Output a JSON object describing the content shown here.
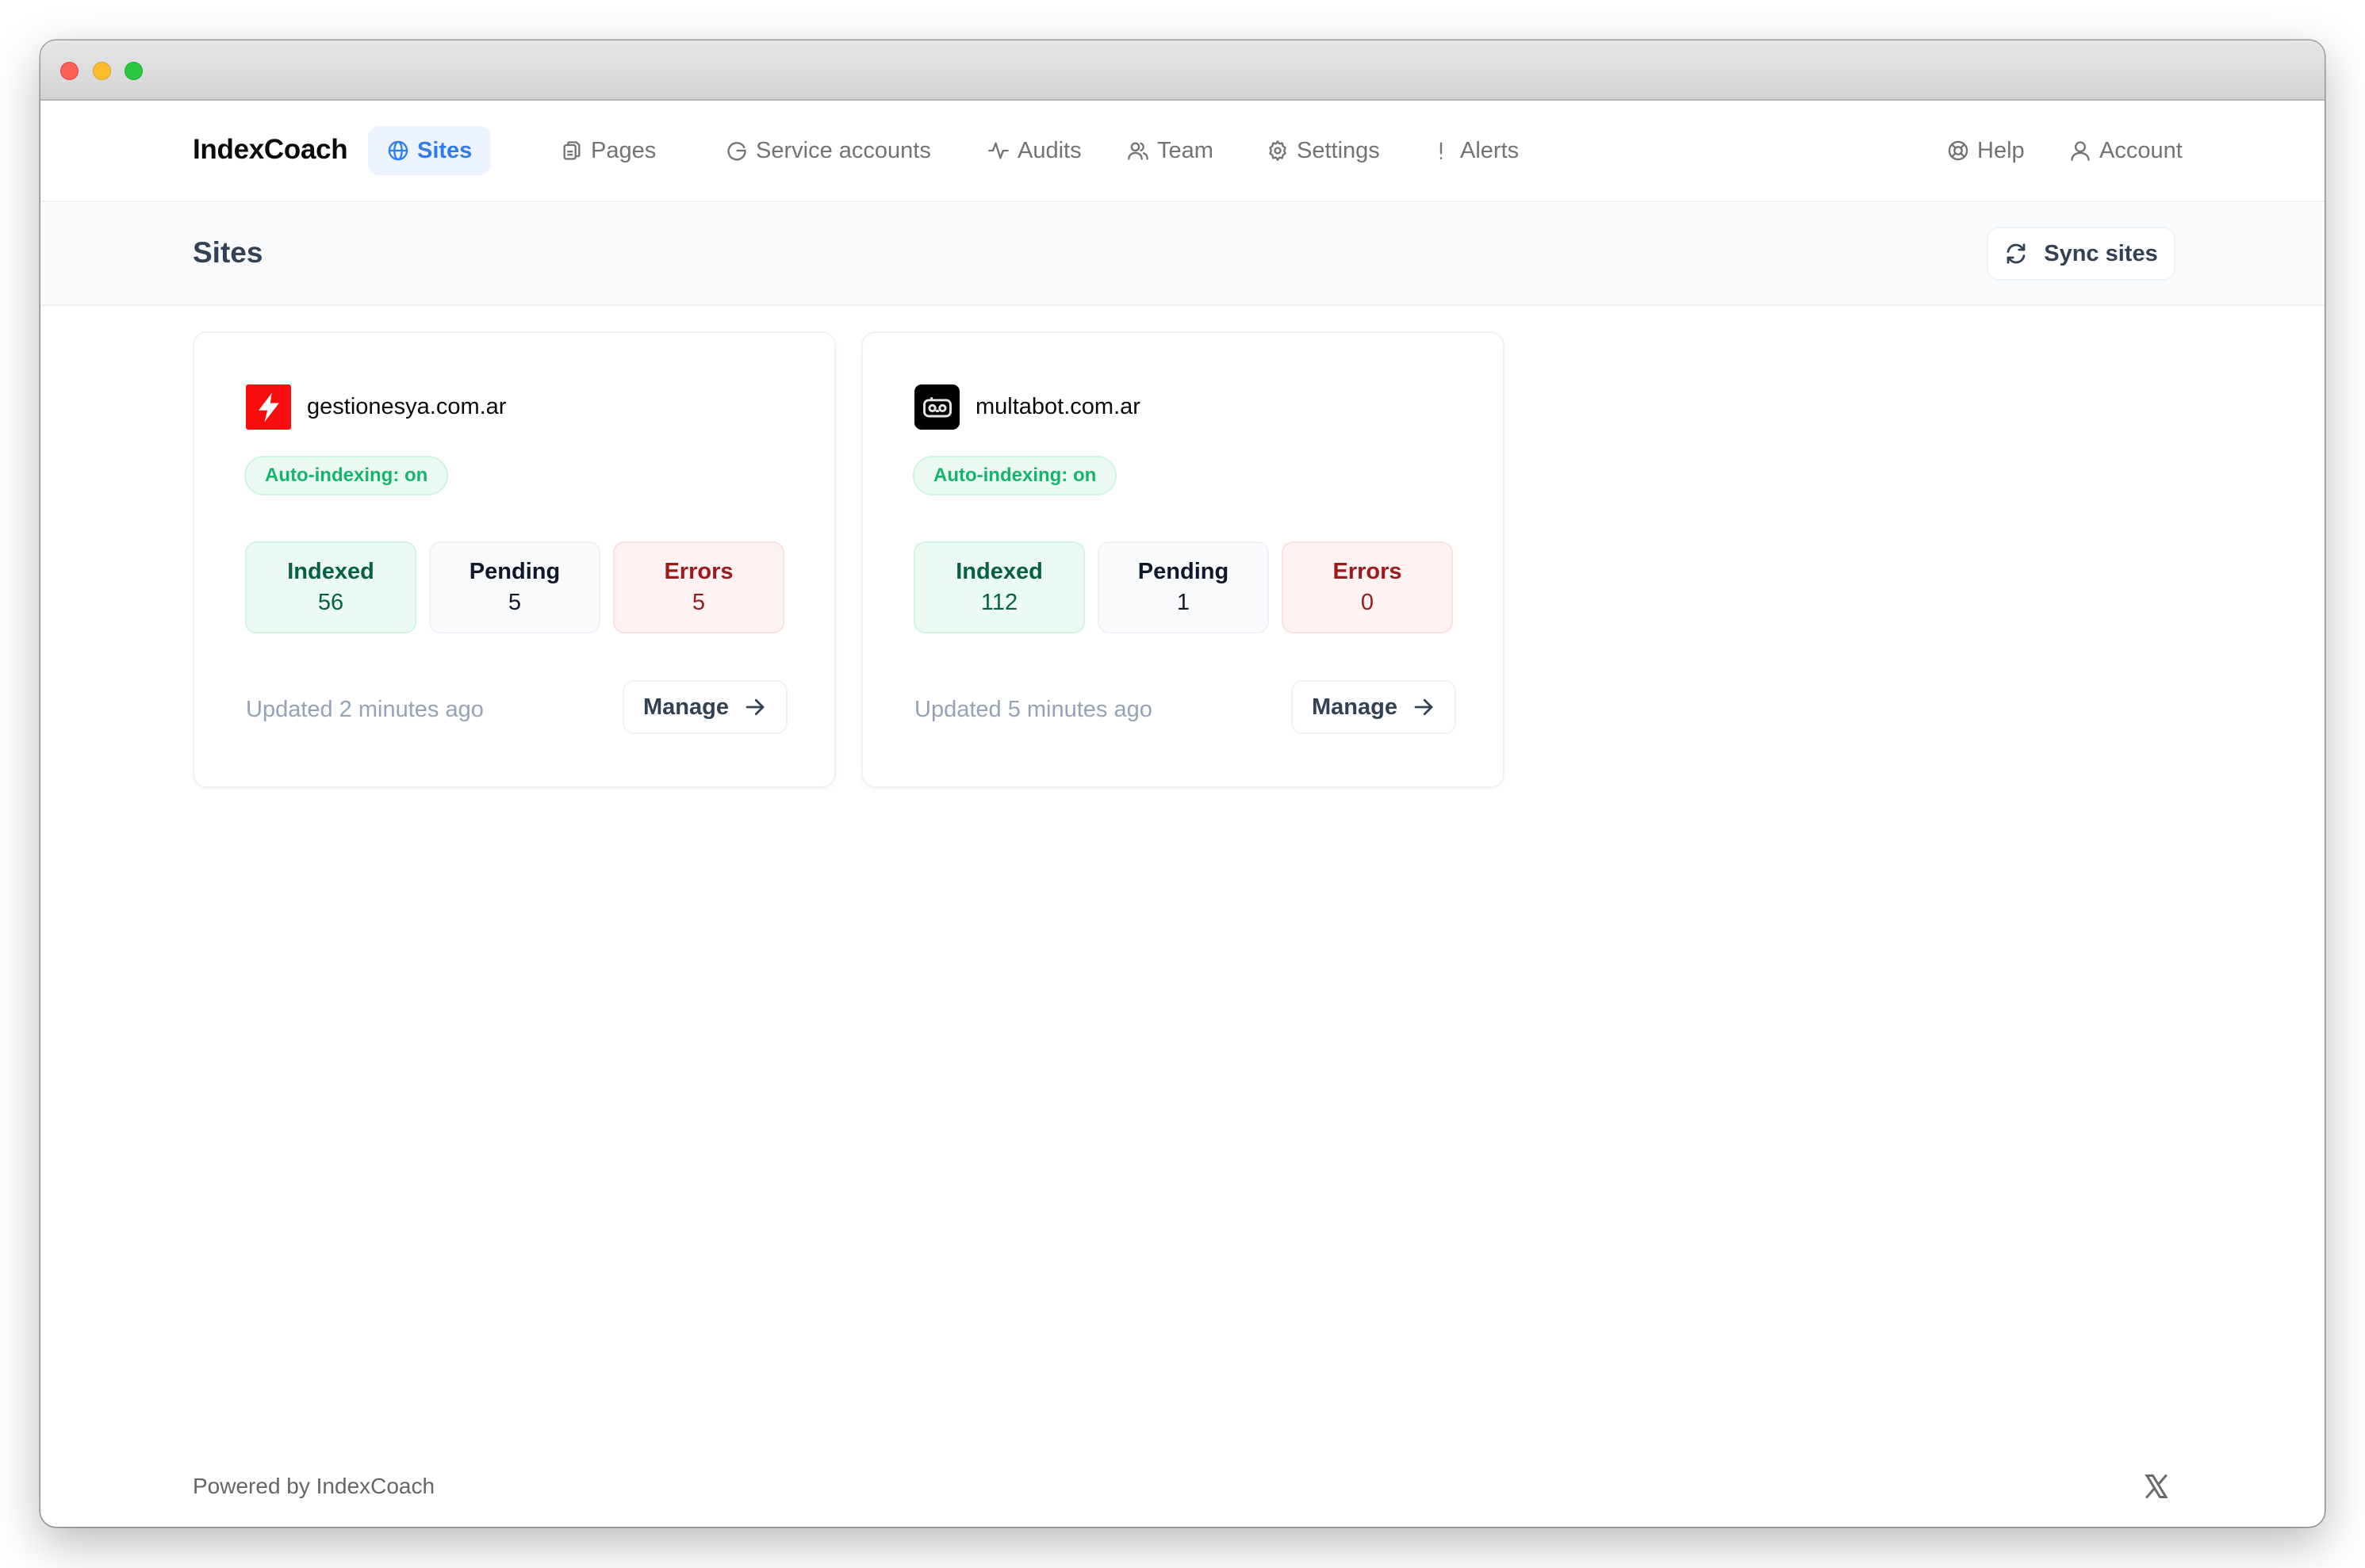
{
  "window": {
    "controls": [
      "close",
      "minimize",
      "maximize"
    ]
  },
  "navbar": {
    "brand": "IndexCoach",
    "items": [
      {
        "label": "Sites",
        "icon": "globe-icon",
        "active": true
      },
      {
        "label": "Pages",
        "icon": "files-icon",
        "active": false
      },
      {
        "label": "Service accounts",
        "icon": "google-icon",
        "active": false
      },
      {
        "label": "Audits",
        "icon": "activity-icon",
        "active": false
      },
      {
        "label": "Team",
        "icon": "users-icon",
        "active": false
      },
      {
        "label": "Settings",
        "icon": "gear-icon",
        "active": false
      },
      {
        "label": "Alerts",
        "icon": "exclamation-icon",
        "active": false
      }
    ],
    "right_items": [
      {
        "label": "Help",
        "icon": "lifebuoy-icon"
      },
      {
        "label": "Account",
        "icon": "user-icon"
      }
    ],
    "active_color": "#2f7cf0"
  },
  "page_header": {
    "title": "Sites",
    "sync_button": "Sync sites"
  },
  "sites": [
    {
      "domain": "gestionesya.com.ar",
      "favicon": "lightning-bolt-icon",
      "auto_indexing": "Auto-indexing: on",
      "stats": {
        "indexed": {
          "label": "Indexed",
          "value": "56"
        },
        "pending": {
          "label": "Pending",
          "value": "5"
        },
        "errors": {
          "label": "Errors",
          "value": "5"
        }
      },
      "updated": "Updated 2 minutes ago",
      "manage": "Manage"
    },
    {
      "domain": "multabot.com.ar",
      "favicon": "robot-icon",
      "auto_indexing": "Auto-indexing: on",
      "stats": {
        "indexed": {
          "label": "Indexed",
          "value": "112"
        },
        "pending": {
          "label": "Pending",
          "value": "1"
        },
        "errors": {
          "label": "Errors",
          "value": "0"
        }
      },
      "updated": "Updated 5 minutes ago",
      "manage": "Manage"
    }
  ],
  "footer": {
    "powered_by": "Powered by IndexCoach",
    "social": "x-logo-icon"
  },
  "colors": {
    "indexed": "#065f46",
    "pending": "#0f172a",
    "errors": "#991b1b",
    "auto_badge": "#16b36f"
  }
}
